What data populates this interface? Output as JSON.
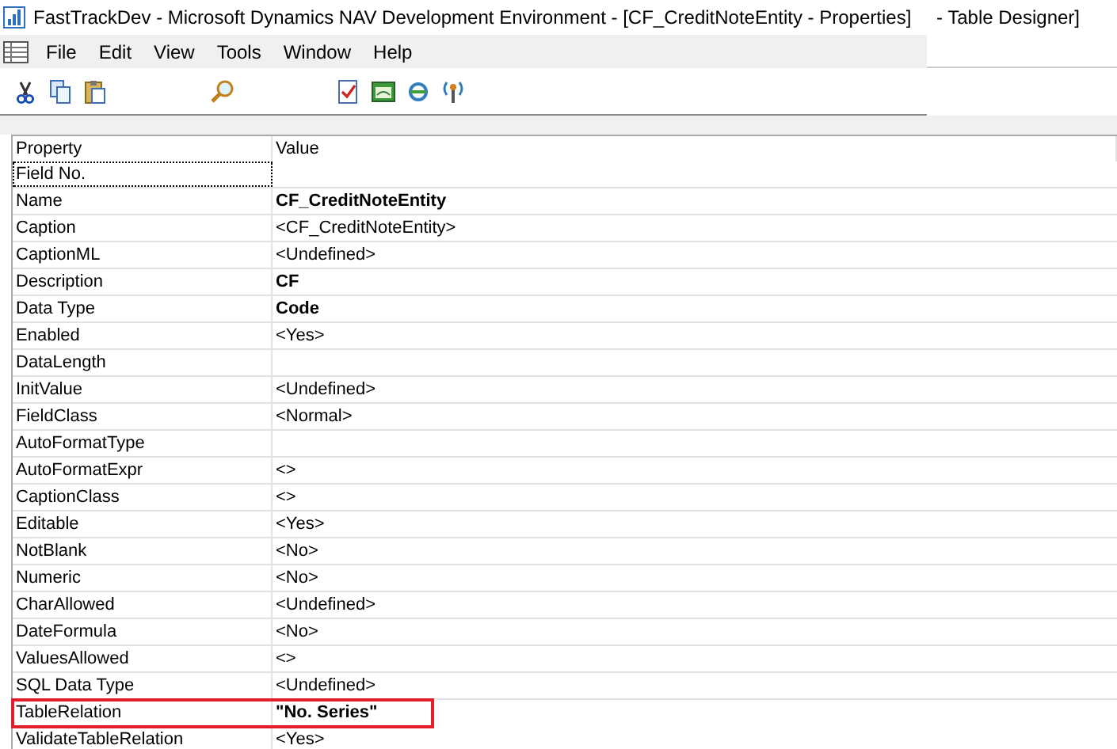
{
  "window": {
    "title": "FastTrackDev - Microsoft Dynamics NAV Development Environment - [CF_CreditNoteEntity - Properties]",
    "background_title": "- Table Designer]"
  },
  "menu": [
    "File",
    "Edit",
    "View",
    "Tools",
    "Window",
    "Help"
  ],
  "table": {
    "columns": [
      "Property",
      "Value"
    ],
    "rows": [
      {
        "property": "Field No.",
        "selected": true,
        "highlighted": false
      },
      {
        "property": "Name",
        "value": "CF_CreditNoteEntity",
        "bold": true,
        "selected": false,
        "highlighted": false
      },
      {
        "property": "Caption",
        "value": "<CF_CreditNoteEntity>",
        "bold": false,
        "selected": false,
        "highlighted": false
      },
      {
        "property": "CaptionML",
        "value": "<Undefined>",
        "bold": false,
        "selected": false,
        "highlighted": false
      },
      {
        "property": "Description",
        "value": "CF",
        "bold": true,
        "selected": false,
        "highlighted": false
      },
      {
        "property": "Data Type",
        "value": "Code",
        "bold": true,
        "selected": false,
        "highlighted": false
      },
      {
        "property": "Enabled",
        "value": "<Yes>",
        "bold": false,
        "selected": false,
        "highlighted": false
      },
      {
        "property": "DataLength",
        "selected": false,
        "highlighted": false
      },
      {
        "property": "InitValue",
        "value": "<Undefined>",
        "bold": false,
        "selected": false,
        "highlighted": false
      },
      {
        "property": "FieldClass",
        "value": "<Normal>",
        "bold": false,
        "selected": false,
        "highlighted": false
      },
      {
        "property": "AutoFormatType",
        "selected": false,
        "highlighted": false
      },
      {
        "property": "AutoFormatExpr",
        "value": "<>",
        "bold": false,
        "selected": false,
        "highlighted": false
      },
      {
        "property": "CaptionClass",
        "value": "<>",
        "bold": false,
        "selected": false,
        "highlighted": false
      },
      {
        "property": "Editable",
        "value": "<Yes>",
        "bold": false,
        "selected": false,
        "highlighted": false
      },
      {
        "property": "NotBlank",
        "value": "<No>",
        "bold": false,
        "selected": false,
        "highlighted": false
      },
      {
        "property": "Numeric",
        "value": "<No>",
        "bold": false,
        "selected": false,
        "highlighted": false
      },
      {
        "property": "CharAllowed",
        "value": "<Undefined>",
        "bold": false,
        "selected": false,
        "highlighted": false
      },
      {
        "property": "DateFormula",
        "value": "<No>",
        "bold": false,
        "selected": false,
        "highlighted": false
      },
      {
        "property": "ValuesAllowed",
        "value": "<>",
        "bold": false,
        "selected": false,
        "highlighted": false
      },
      {
        "property": "SQL Data Type",
        "value": "<Undefined>",
        "bold": false,
        "selected": false,
        "highlighted": false
      },
      {
        "property": "TableRelation",
        "value": "\"No. Series\"",
        "bold": true,
        "selected": false,
        "highlighted": true
      },
      {
        "property": "ValidateTableRelation",
        "value": "<Yes>",
        "bold": false,
        "selected": false,
        "highlighted": false
      }
    ]
  }
}
